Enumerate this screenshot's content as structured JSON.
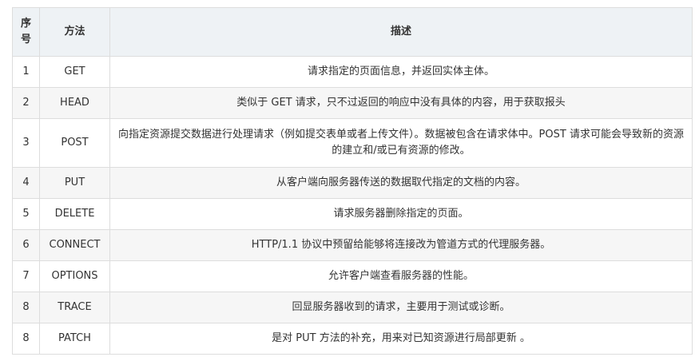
{
  "table": {
    "headers": {
      "no": "序号",
      "method": "方法",
      "desc": "描述"
    },
    "rows": [
      {
        "no": "1",
        "method": "GET",
        "desc": "请求指定的页面信息，并返回实体主体。"
      },
      {
        "no": "2",
        "method": "HEAD",
        "desc": "类似于 GET 请求，只不过返回的响应中没有具体的内容，用于获取报头"
      },
      {
        "no": "3",
        "method": "POST",
        "desc": "向指定资源提交数据进行处理请求（例如提交表单或者上传文件）。数据被包含在请求体中。POST 请求可能会导致新的资源的建立和/或已有资源的修改。"
      },
      {
        "no": "4",
        "method": "PUT",
        "desc": "从客户端向服务器传送的数据取代指定的文档的内容。"
      },
      {
        "no": "5",
        "method": "DELETE",
        "desc": "请求服务器删除指定的页面。"
      },
      {
        "no": "6",
        "method": "CONNECT",
        "desc": "HTTP/1.1 协议中预留给能够将连接改为管道方式的代理服务器。"
      },
      {
        "no": "7",
        "method": "OPTIONS",
        "desc": "允许客户端查看服务器的性能。"
      },
      {
        "no": "8",
        "method": "TRACE",
        "desc": "回显服务器收到的请求，主要用于测试或诊断。"
      },
      {
        "no": "8",
        "method": "PATCH",
        "desc": "是对 PUT 方法的补充，用来对已知资源进行局部更新 。"
      }
    ]
  }
}
